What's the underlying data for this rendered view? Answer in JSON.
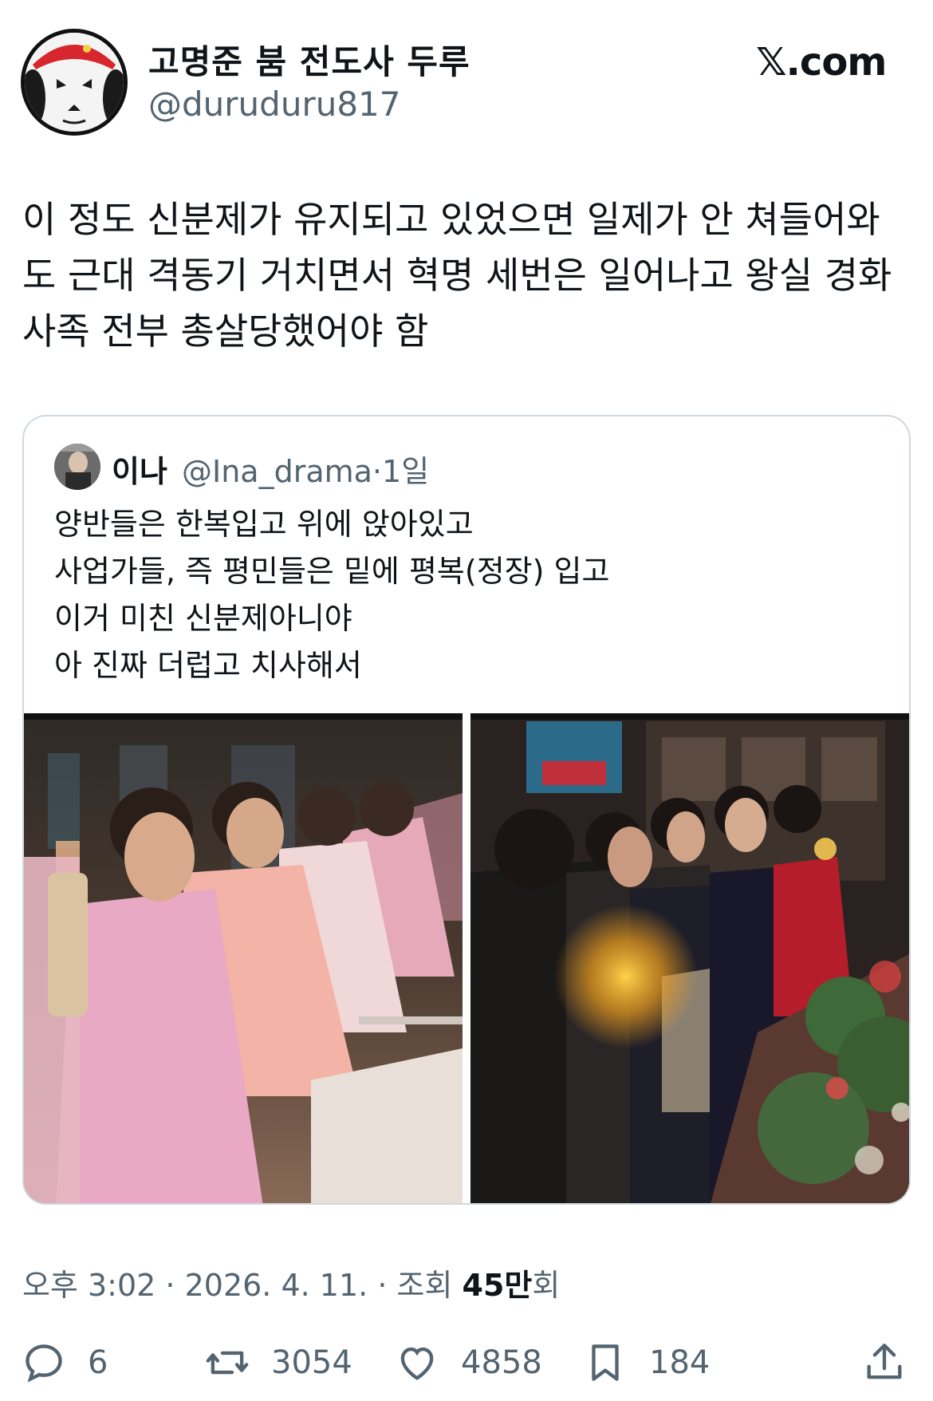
{
  "author": {
    "display_name": "고명준 붐 전도사 두루",
    "handle": "@duruduru817"
  },
  "site_label": "𝕏.com",
  "tweet": {
    "lines": [
      "이 정도 신분제가 유지되고 있었으면 일제가 안 쳐들어와",
      "도 근대 격동기 거치면서 혁명 세번은 일어나고 왕실 경화",
      "사족 전부 총살당했어야 함"
    ]
  },
  "quote": {
    "name": "이나",
    "handle": "@Ina_drama",
    "age": "1일",
    "lines": [
      "양반들은 한복입고 위에 앉아있고",
      "사업가들, 즉 평민들은 밑에 평복(정장) 입고",
      "이거 미친 신분제아니야",
      "아 진짜 더럽고 치사해서"
    ]
  },
  "meta": {
    "time": "오후 3:02",
    "date": "2026. 4. 11.",
    "views_label": "조회",
    "views_count": "45만",
    "views_suffix": "회"
  },
  "actions": {
    "replies": "6",
    "reposts": "3054",
    "likes": "4858",
    "bookmarks": "184"
  },
  "colors": {
    "text": "#0f1419",
    "secondary": "#536471",
    "border": "#cfd9de"
  }
}
